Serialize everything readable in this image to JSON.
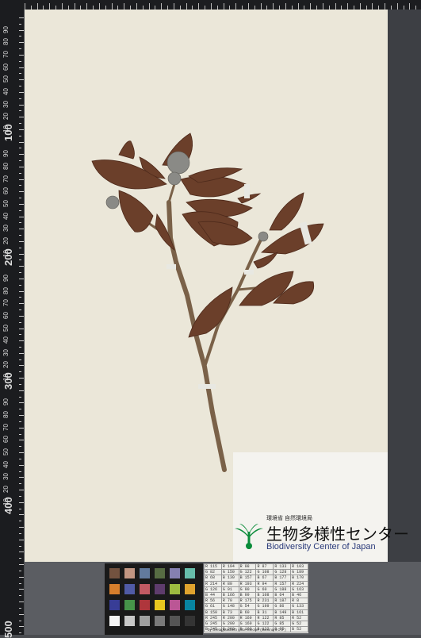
{
  "ruler": {
    "major_labels": [
      "100",
      "200",
      "300",
      "400",
      "500"
    ],
    "minor_labels": [
      "10",
      "20",
      "30",
      "40",
      "50",
      "60",
      "70",
      "80",
      "90",
      "10",
      "20",
      "30",
      "40",
      "50",
      "60",
      "70",
      "80",
      "90",
      "10",
      "20",
      "30",
      "40",
      "50",
      "60",
      "70",
      "80",
      "90",
      "10",
      "20",
      "30",
      "40",
      "50",
      "60",
      "70",
      "80",
      "90",
      "10",
      "20",
      "30",
      "40",
      "50",
      "60",
      "70",
      "80",
      "90"
    ]
  },
  "logo": {
    "ministry": "環境省 自然環境局",
    "name_jp": "生物多様性センター",
    "name_en": "Biodiversity Center of Japan"
  },
  "color_table": {
    "rows": [
      [
        "R 115",
        "R 194",
        "R 98",
        "R 87",
        "R 133",
        "R 103"
      ],
      [
        "G 82",
        "G 150",
        "G 122",
        "G 108",
        "G 128",
        "G 189"
      ],
      [
        "B 68",
        "B 130",
        "B 157",
        "B 67",
        "B 177",
        "B 170"
      ],
      [
        "R 214",
        "R 80",
        "R 193",
        "R 94",
        "R 157",
        "R 224"
      ],
      [
        "G 126",
        "G 91",
        "G 90",
        "G 60",
        "G 188",
        "G 163"
      ],
      [
        "B 44",
        "B 166",
        "B 99",
        "B 108",
        "B 64",
        "B 46"
      ],
      [
        "R 56",
        "R 70",
        "R 175",
        "R 231",
        "R 187",
        "R 8"
      ],
      [
        "G 61",
        "G 148",
        "G 54",
        "G 199",
        "G 86",
        "G 133"
      ],
      [
        "B 150",
        "B 73",
        "B 60",
        "B 31",
        "B 149",
        "B 161"
      ],
      [
        "R 245",
        "R 200",
        "R 160",
        "R 122",
        "R 85",
        "R 52"
      ],
      [
        "G 245",
        "G 200",
        "G 160",
        "G 122",
        "G 85",
        "G 52"
      ],
      [
        "B 245",
        "B 200",
        "B 160",
        "B 122",
        "B 85",
        "B 52"
      ]
    ],
    "caption": "by GretagMacbeth color checker (Illuminant C 2°)"
  },
  "colors": {
    "sheet": "#ebe7d9",
    "leaf": "#6b3f2a",
    "stem": "#7a6148"
  }
}
